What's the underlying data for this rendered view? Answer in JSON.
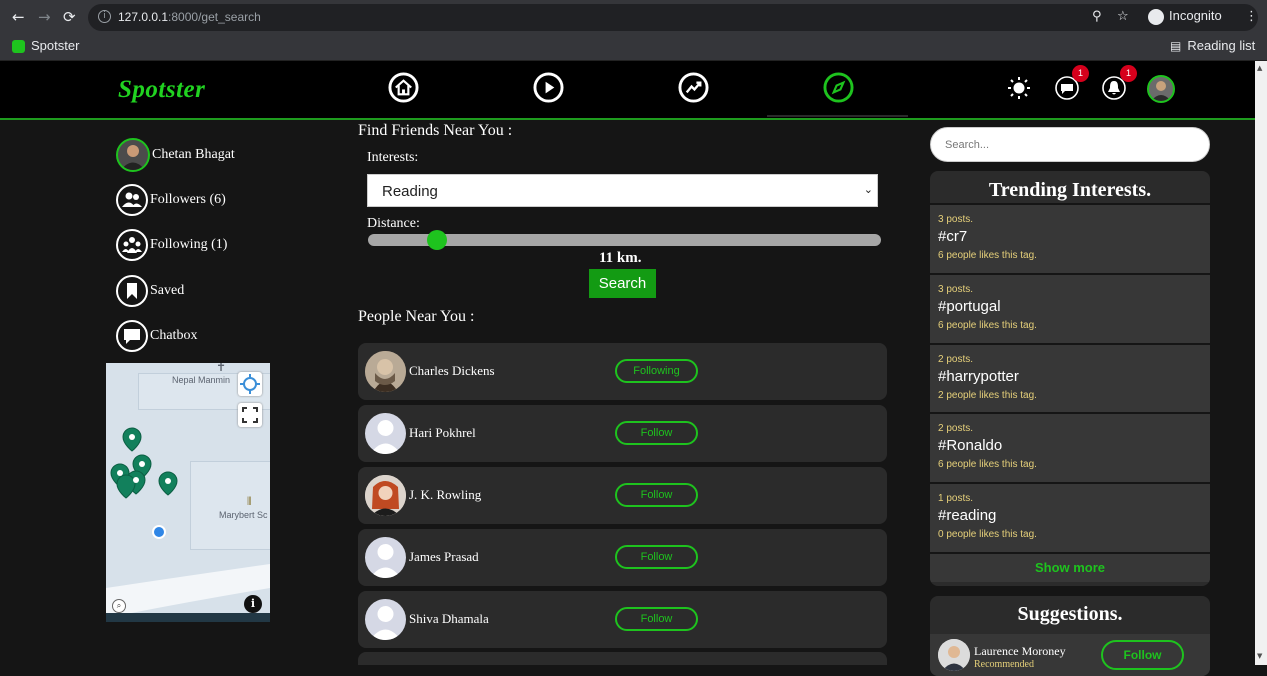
{
  "browser": {
    "url_host": "127.0.0.1",
    "url_path": ":8000/get_search",
    "profile_label": "Incognito",
    "bookmark": "Spotster",
    "reading_list": "Reading list"
  },
  "header": {
    "logo": "Spotster",
    "message_badge": "1",
    "notification_badge": "1"
  },
  "sidebar": {
    "user_name": "Chetan Bhagat",
    "items": [
      {
        "label": "Followers (6)"
      },
      {
        "label": "Following (1)"
      },
      {
        "label": "Saved"
      },
      {
        "label": "Chatbox"
      }
    ],
    "map_labels": [
      "Nepal Manmin",
      "Marybert Sc"
    ]
  },
  "main": {
    "find_title": "Find Friends Near You :",
    "interests_label": "Interests:",
    "interest_selected": "Reading",
    "distance_label": "Distance:",
    "distance_value": "11 km.",
    "distance_fraction": 0.12,
    "search_label": "Search",
    "people_title": "People Near You :",
    "people": [
      {
        "name": "Charles Dickens",
        "action": "Following"
      },
      {
        "name": "Hari Pokhrel",
        "action": "Follow"
      },
      {
        "name": "J. K. Rowling",
        "action": "Follow"
      },
      {
        "name": "James Prasad",
        "action": "Follow"
      },
      {
        "name": "Shiva Dhamala",
        "action": "Follow"
      }
    ]
  },
  "right": {
    "search_placeholder": "Search...",
    "trending_title": "Trending Interests.",
    "trending": [
      {
        "posts": "3 posts.",
        "tag": "#cr7",
        "likes": "6 people likes this tag."
      },
      {
        "posts": "3 posts.",
        "tag": "#portugal",
        "likes": "6 people likes this tag."
      },
      {
        "posts": "2 posts.",
        "tag": "#harrypotter",
        "likes": "2 people likes this tag."
      },
      {
        "posts": "2 posts.",
        "tag": "#Ronaldo",
        "likes": "6 people likes this tag."
      },
      {
        "posts": "1 posts.",
        "tag": "#reading",
        "likes": "0 people likes this tag."
      }
    ],
    "show_more": "Show more",
    "suggestions_title": "Suggestions.",
    "suggestion": {
      "name": "Laurence Moroney",
      "sub": "Recommended",
      "action": "Follow"
    }
  },
  "colors": {
    "accent": "#1ec31e",
    "badge": "#d6001c",
    "panel": "#2b2b2b"
  }
}
